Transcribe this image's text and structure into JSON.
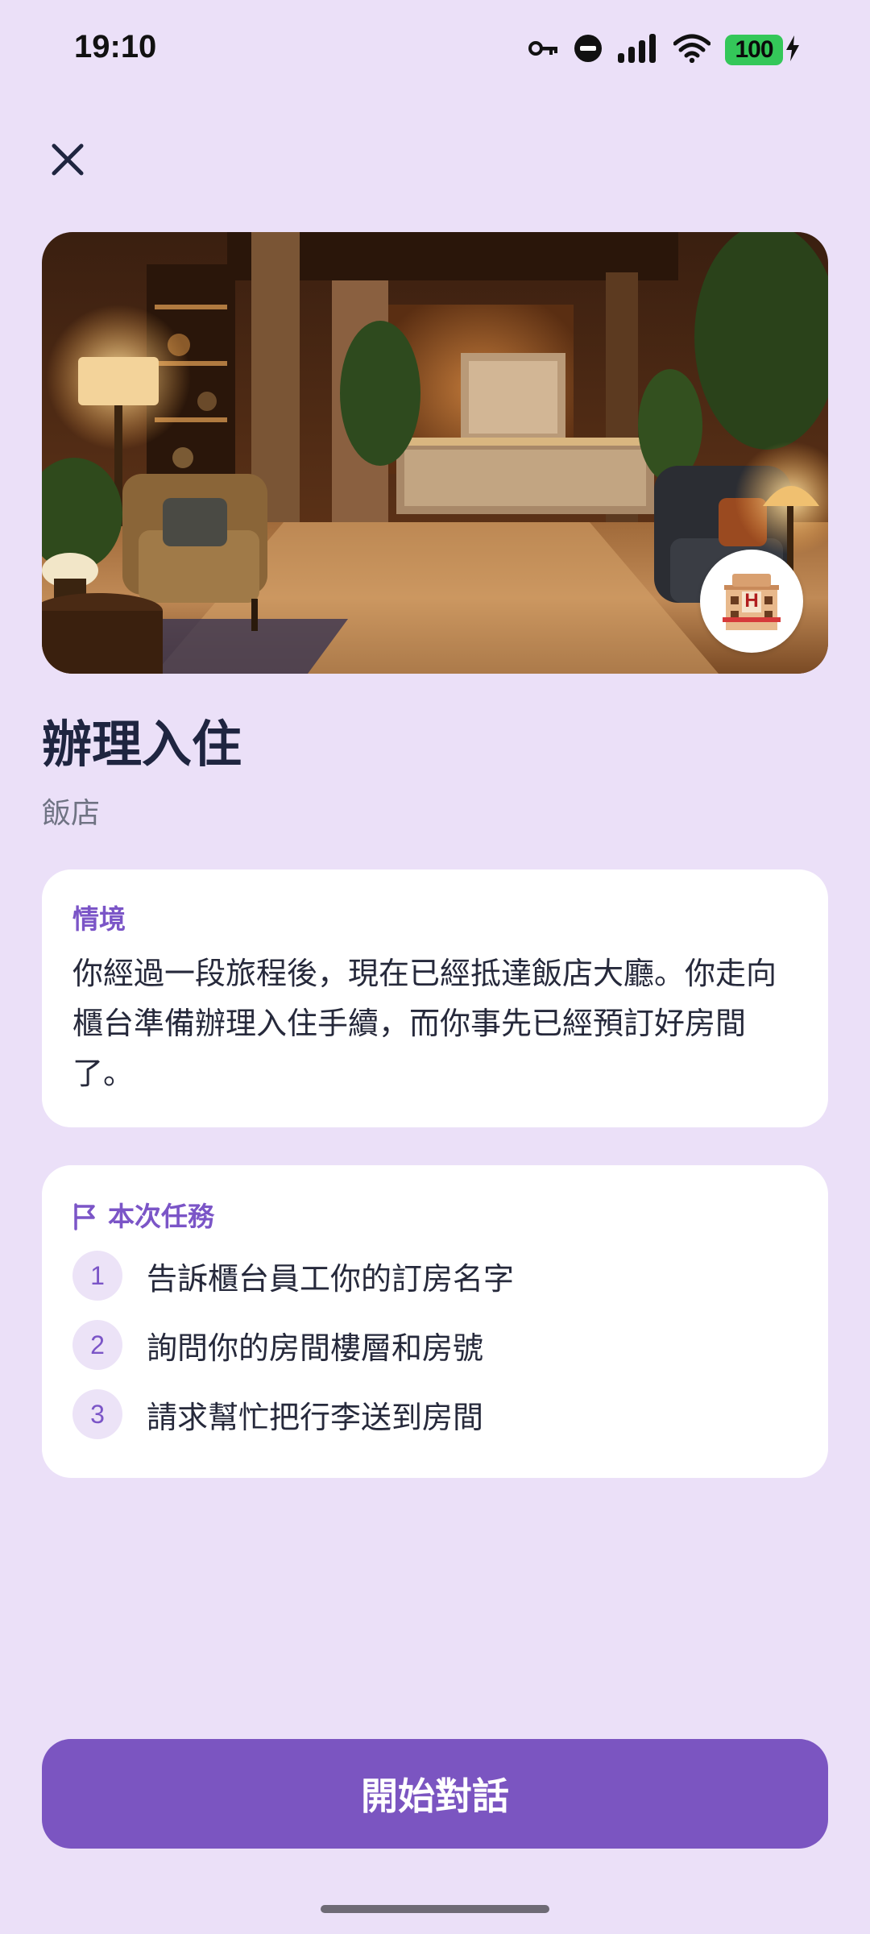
{
  "status_bar": {
    "time": "19:10",
    "battery": "100",
    "icons": [
      "vpn-key-icon",
      "do-not-disturb-icon",
      "signal-icon",
      "wifi-icon",
      "battery-charging-icon"
    ]
  },
  "header": {
    "close_icon": "close-icon"
  },
  "hero": {
    "image": "hotel-lobby-photo",
    "badge_icon": "hotel-icon",
    "badge_letter": "H"
  },
  "scenario": {
    "title": "辦理入住",
    "category": "飯店",
    "context_label": "情境",
    "context_text": "你經過一段旅程後，現在已經抵達飯店大廳。你走向櫃台準備辦理入住手續，而你事先已經預訂好房間了。"
  },
  "tasks": {
    "heading": "本次任務",
    "heading_icon": "flag-icon",
    "items": [
      {
        "number": "1",
        "text": "告訴櫃台員工你的訂房名字"
      },
      {
        "number": "2",
        "text": "詢問你的房間樓層和房號"
      },
      {
        "number": "3",
        "text": "請求幫忙把行李送到房間"
      }
    ]
  },
  "actions": {
    "start_label": "開始對話"
  },
  "colors": {
    "background": "#ebe0f8",
    "accent": "#7b55c1",
    "card": "#ffffff",
    "title": "#1f2540"
  }
}
